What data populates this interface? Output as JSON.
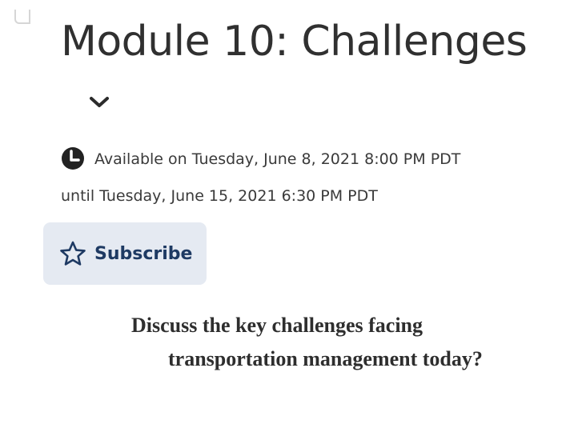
{
  "module": {
    "title": "Module 10: Challenges"
  },
  "availability": {
    "line1": "Available on Tuesday, June 8, 2021 8:00 PM PDT",
    "line2": "until Tuesday, June 15, 2021 6:30 PM PDT",
    "icon": "clock-icon"
  },
  "subscribe": {
    "label": "Subscribe",
    "icon": "star-outline-icon"
  },
  "content": {
    "question_line1": "Discuss the key challenges facing",
    "question_line2": "transportation management today?"
  },
  "colors": {
    "button_bg": "#e5eaf2",
    "button_text": "#1e3a63",
    "title_text": "#303030"
  }
}
